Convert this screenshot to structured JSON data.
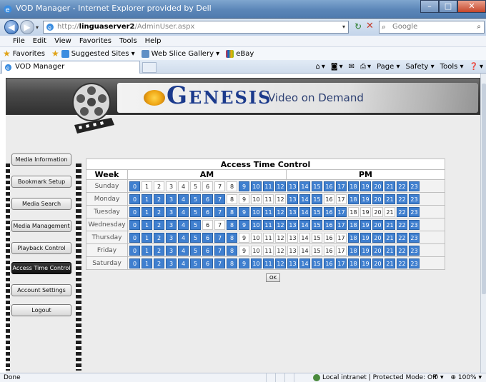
{
  "window": {
    "title": "VOD Manager - Internet Explorer provided by Dell",
    "minimize": "–",
    "maximize": "□",
    "close": "✕"
  },
  "address": {
    "url_prefix": "http://",
    "url_host": "linguaserver2",
    "url_path": "/AdminUser.aspx",
    "search_placeholder": "Google"
  },
  "menu": [
    "File",
    "Edit",
    "View",
    "Favorites",
    "Tools",
    "Help"
  ],
  "favorites": {
    "label": "Favorites",
    "items": [
      "Suggested Sites ▾",
      "Web Slice Gallery ▾",
      "eBay"
    ]
  },
  "tab": {
    "label": "VOD Manager"
  },
  "commands": [
    "Page ▾",
    "Safety ▾",
    "Tools ▾"
  ],
  "banner": {
    "brand": "Genesis",
    "tagline": "Video on Demand",
    "trademark": "™"
  },
  "nav": [
    "Media Information",
    "Bookmark Setup",
    "Media Search",
    "Media Management",
    "Playback Control",
    "Access Time Control",
    "Account Settings",
    "Logout"
  ],
  "nav_active": "Access Time Control",
  "access": {
    "title": "Access Time Control",
    "week_header": "Week",
    "am_header": "AM",
    "pm_header": "PM",
    "hours": [
      "0",
      "1",
      "2",
      "3",
      "4",
      "5",
      "6",
      "7",
      "8",
      "9",
      "10",
      "11",
      "12",
      "13",
      "14",
      "15",
      "16",
      "17",
      "18",
      "19",
      "20",
      "21",
      "22",
      "23"
    ],
    "rows": [
      {
        "day": "Sunday",
        "off": [
          1,
          2,
          3,
          4,
          5,
          6,
          7,
          8
        ]
      },
      {
        "day": "Monday",
        "off": [
          8,
          9,
          10,
          11,
          12,
          16,
          17
        ]
      },
      {
        "day": "Tuesday",
        "off": [
          18,
          19,
          20,
          21
        ]
      },
      {
        "day": "Wednesday",
        "off": [
          6,
          7
        ]
      },
      {
        "day": "Thursday",
        "off": [
          9,
          10,
          11,
          12,
          13,
          14,
          15,
          16,
          17
        ]
      },
      {
        "day": "Friday",
        "off": [
          9,
          10,
          11,
          12,
          13,
          14,
          15,
          16,
          17
        ]
      },
      {
        "day": "Saturday",
        "off": []
      }
    ],
    "ok_label": "OK"
  },
  "status": {
    "left": "Done",
    "zone": "Local intranet | Protected Mode: Off",
    "zoom": "100%"
  },
  "colors": {
    "on": "#3f7fcf",
    "off": "#ffffff"
  }
}
